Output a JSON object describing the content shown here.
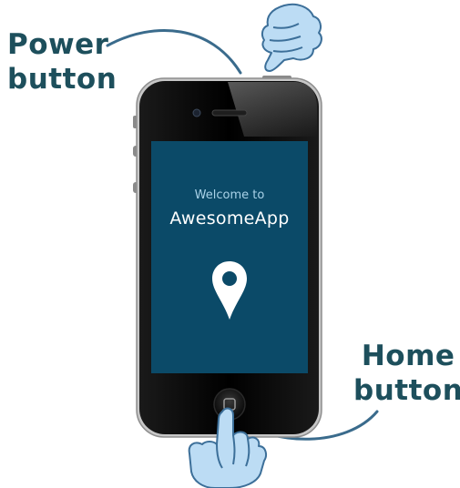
{
  "annotations": {
    "power_line1": "Power",
    "power_line2": "button",
    "home_line1": "Home",
    "home_line2": "button"
  },
  "app_screen": {
    "welcome_text": "Welcome to",
    "app_name": "AwesomeApp",
    "icon": "location-pin-icon",
    "background_color": "#0b4a68"
  },
  "colors": {
    "annotation_text": "#1d4f5c",
    "hand_fill": "#bcdcf4",
    "hand_stroke": "#3c6f99"
  },
  "icons": [
    "hand-pointer-icon",
    "location-pin-icon",
    "home-button-icon"
  ]
}
